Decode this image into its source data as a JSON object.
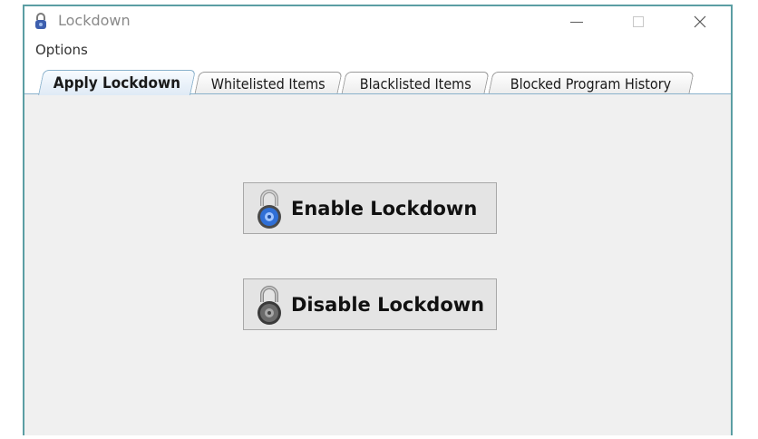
{
  "window": {
    "title": "Lockdown",
    "icon": "padlock-icon",
    "controls": {
      "minimize": "minimize-icon",
      "maximize": "maximize-icon",
      "close": "close-icon"
    }
  },
  "menubar": {
    "items": [
      {
        "label": "Options"
      }
    ]
  },
  "tabs": [
    {
      "label": "Apply Lockdown",
      "active": true
    },
    {
      "label": "Whitelisted Items",
      "active": false
    },
    {
      "label": "Blacklisted Items",
      "active": false
    },
    {
      "label": "Blocked Program History",
      "active": false
    }
  ],
  "actions": {
    "enable": {
      "label": "Enable Lockdown",
      "icon": "blue-padlock-icon"
    },
    "disable": {
      "label": "Disable Lockdown",
      "icon": "gray-padlock-icon"
    }
  },
  "colors": {
    "window_border": "#5b9ea3",
    "tab_active_bg": "#dfeaf5",
    "enable_lock": "#2f6fd6",
    "disable_lock": "#555555"
  }
}
